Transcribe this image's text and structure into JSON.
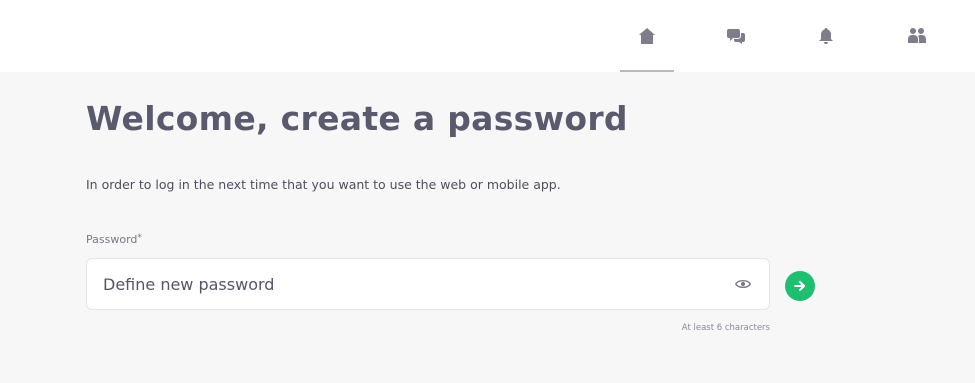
{
  "nav": {
    "items": [
      {
        "icon": "home-icon",
        "active": true
      },
      {
        "icon": "chat-icon",
        "active": false
      },
      {
        "icon": "bell-icon",
        "active": false
      },
      {
        "icon": "users-icon",
        "active": false
      }
    ]
  },
  "form": {
    "title": "Welcome, create a password",
    "subtitle": "In order to log in the next time that you want to use the web or mobile app.",
    "password_label": "Password",
    "required_marker": "*",
    "password_placeholder": "Define new password",
    "password_value": "",
    "hint": "At least 6 characters"
  },
  "colors": {
    "accent": "#1fbf72",
    "background": "#f7f7f8",
    "topbar": "#ffffff"
  }
}
